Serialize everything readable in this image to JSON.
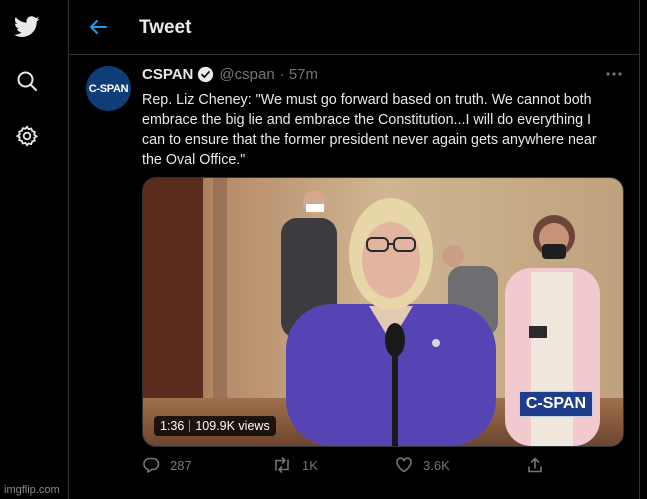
{
  "header": {
    "title": "Tweet"
  },
  "tweet": {
    "author_name": "CSPAN",
    "handle": "@cspan",
    "time": "· 57m",
    "avatar_text": "C-SPAN",
    "text": "Rep. Liz Cheney: \"We must go forward based on truth. We cannot both\nembrace the big lie and embrace the Constitution...I will do everything I\ncan to ensure that the former president never again gets anywhere near\nthe Oval Office.\""
  },
  "video": {
    "duration": "1:36",
    "views": "109.9K views",
    "logo_text": "C-SPAN"
  },
  "actions": {
    "replies": "287",
    "retweets": "1K",
    "likes": "3.6K"
  },
  "watermark": "imgflip.com",
  "icons": {
    "nav": [
      "twitter-logo",
      "search",
      "gear"
    ],
    "header": "back-arrow",
    "tweet": [
      "verified-badge",
      "more"
    ],
    "actions": [
      "reply",
      "retweet",
      "like",
      "share"
    ]
  },
  "colors": {
    "accent": "#1d9bf0",
    "background": "#000000",
    "text": "#e7e9ea",
    "muted": "#71767b",
    "border": "#2f3336"
  }
}
